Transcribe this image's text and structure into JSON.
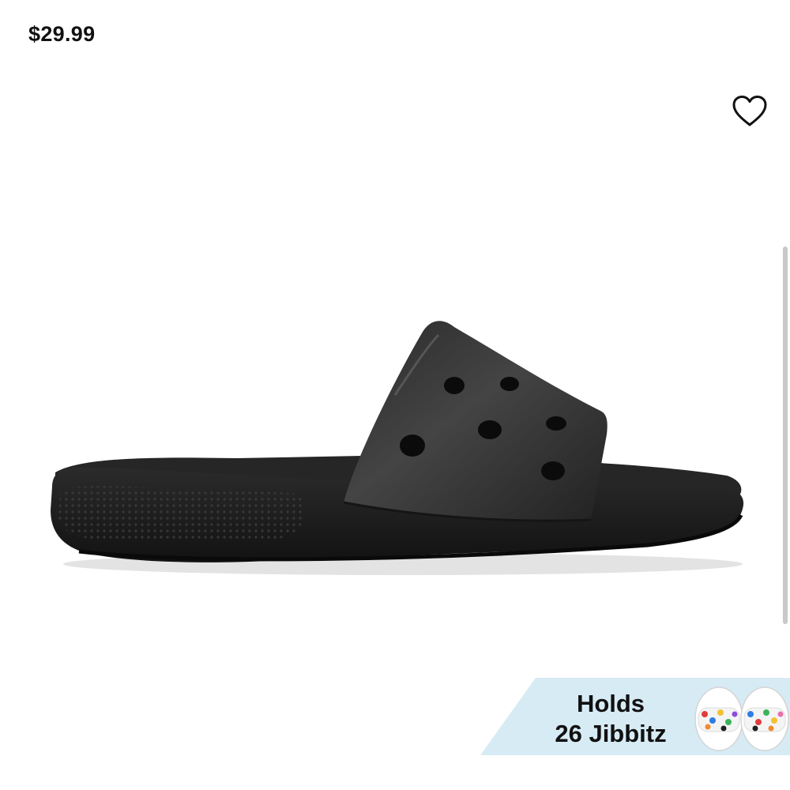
{
  "product": {
    "price": "$29.99"
  },
  "icons": {
    "favorite": "heart-outline-icon"
  },
  "promo_banner": {
    "line1": "Holds",
    "line2": "26 Jibbitz"
  },
  "colors": {
    "banner_bg": "#d7ebf5",
    "product": "#1f1f1f",
    "text": "#111111"
  }
}
